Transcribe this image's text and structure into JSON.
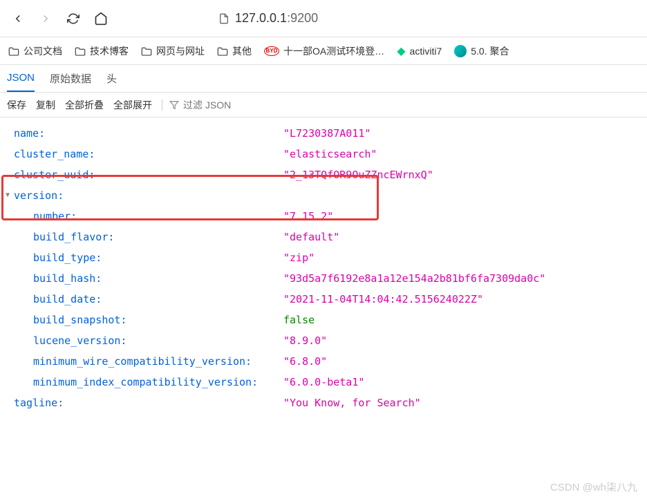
{
  "browser": {
    "url_host": "127.0.0.1",
    "url_port": ":9200"
  },
  "bookmarks": {
    "b1": "公司文档",
    "b2": "技术博客",
    "b3": "网页与网址",
    "b4": "其他",
    "b5": "十一部OA测试环境登…",
    "b6": "activiti7",
    "b7": "5.0. 聚合"
  },
  "tabs": {
    "json": "JSON",
    "raw": "原始数据",
    "headers": "头"
  },
  "toolbar_actions": {
    "save": "保存",
    "copy": "复制",
    "collapse_all": "全部折叠",
    "expand_all": "全部展开",
    "filter_placeholder": "过滤 JSON"
  },
  "json": {
    "name_key": "name:",
    "name_val": "\"L7230387A011\"",
    "cluster_name_key": "cluster_name:",
    "cluster_name_val": "\"elasticsearch\"",
    "cluster_uuid_key": "cluster_uuid:",
    "cluster_uuid_val": "\"2_13TQfOR9OuZZncEWrnxQ\"",
    "version_key": "version:",
    "number_key": "number:",
    "number_val": "\"7.15.2\"",
    "build_flavor_key": "build_flavor:",
    "build_flavor_val": "\"default\"",
    "build_type_key": "build_type:",
    "build_type_val": "\"zip\"",
    "build_hash_key": "build_hash:",
    "build_hash_val": "\"93d5a7f6192e8a1a12e154a2b81bf6fa7309da0c\"",
    "build_date_key": "build_date:",
    "build_date_val": "\"2021-11-04T14:04:42.515624022Z\"",
    "build_snapshot_key": "build_snapshot:",
    "build_snapshot_val": "false",
    "lucene_version_key": "lucene_version:",
    "lucene_version_val": "\"8.9.0\"",
    "min_wire_key": "minimum_wire_compatibility_version:",
    "min_wire_val": "\"6.8.0\"",
    "min_index_key": "minimum_index_compatibility_version:",
    "min_index_val": "\"6.0.0-beta1\"",
    "tagline_key": "tagline:",
    "tagline_val": "\"You Know, for Search\""
  },
  "watermark": "CSDN @wh柒八九"
}
